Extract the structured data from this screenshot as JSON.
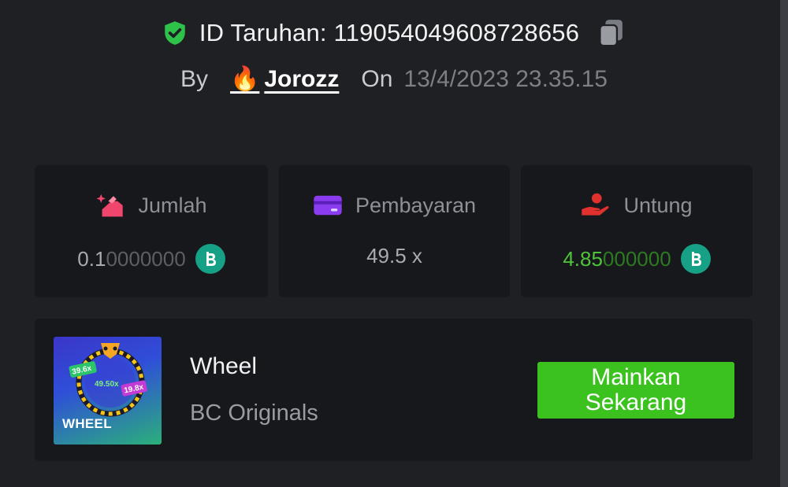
{
  "header": {
    "bet_id_label": "ID Taruhan: 119054049608728656",
    "by_label": "By",
    "username": "Jorozz",
    "user_emoji": "🔥",
    "on_label": "On",
    "date": "13/4/2023 23.35.15"
  },
  "stats": {
    "amount": {
      "label": "Jumlah",
      "value_strong": "0.1",
      "value_faint": "0000000",
      "icon": "bet-amount-icon",
      "coin": "bc-coin-icon"
    },
    "payout": {
      "label": "Pembayaran",
      "value": "49.5 x",
      "icon": "card-icon"
    },
    "profit": {
      "label": "Untung",
      "value_strong": "4.85",
      "value_faint": "000000",
      "icon": "profit-hand-icon",
      "coin": "bc-coin-icon"
    }
  },
  "game": {
    "thumb_label": "WHEEL",
    "thumb_multipliers": [
      "39.6x",
      "49.50x",
      "19.8x"
    ],
    "name": "Wheel",
    "provider": "BC Originals",
    "play_button": "Mainkan Sekarang"
  },
  "colors": {
    "background": "#1f2023",
    "card": "#17181b",
    "accent_green": "#3bc21f",
    "profit_green": "#4fc43a",
    "shield_green": "#2fc24a",
    "coin_teal": "#16a085"
  }
}
